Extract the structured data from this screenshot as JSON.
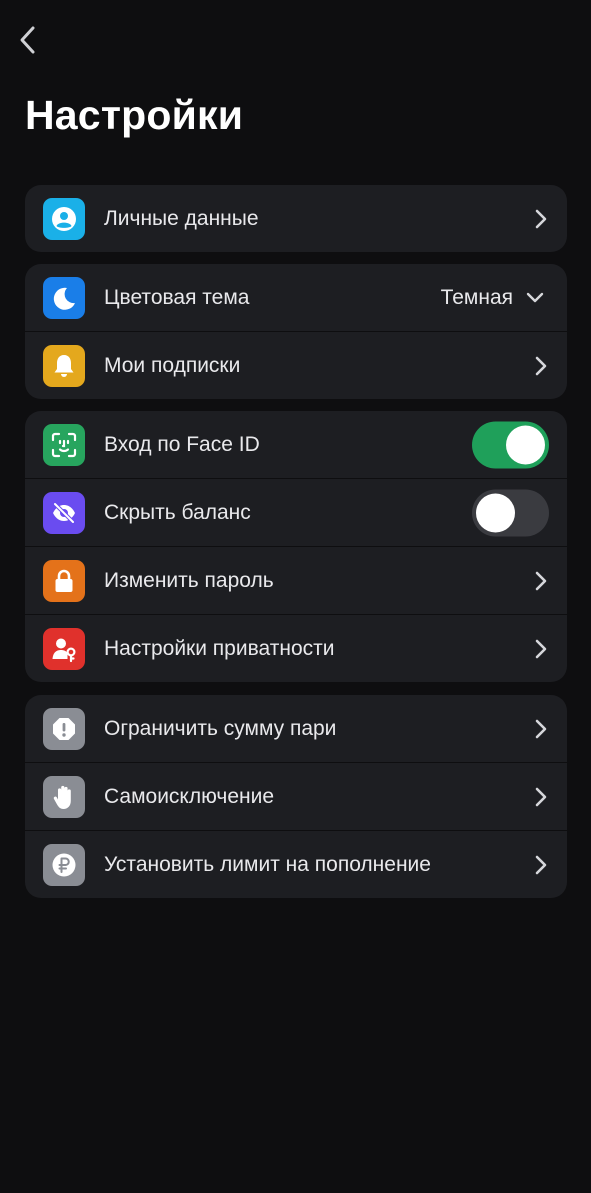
{
  "header": {
    "title": "Настройки",
    "back_icon": "chevron-left-icon"
  },
  "groups": [
    {
      "items": [
        {
          "label": "Личные данные",
          "icon": "user-icon",
          "icon_color": "#1ab0e8",
          "control": "chevron"
        }
      ]
    },
    {
      "items": [
        {
          "label": "Цветовая тема",
          "icon": "moon-icon",
          "icon_color": "#1a7ee8",
          "control": "dropdown",
          "value": "Темная"
        },
        {
          "label": "Мои подписки",
          "icon": "bell-icon",
          "icon_color": "#e4a81d",
          "control": "chevron"
        }
      ]
    },
    {
      "items": [
        {
          "label": "Вход по Face ID",
          "icon": "face-id-icon",
          "icon_color": "#27a55e",
          "control": "toggle",
          "on": true
        },
        {
          "label": "Скрыть баланс",
          "icon": "eye-off-icon",
          "icon_color": "#6a4cf0",
          "control": "toggle",
          "on": false
        },
        {
          "label": "Изменить пароль",
          "icon": "lock-icon",
          "icon_color": "#e4721a",
          "control": "chevron"
        },
        {
          "label": "Настройки приватности",
          "icon": "user-key-icon",
          "icon_color": "#e0312c",
          "control": "chevron"
        }
      ]
    },
    {
      "items": [
        {
          "label": "Ограничить сумму пари",
          "icon": "alert-octagon-icon",
          "icon_color": "#8a8d94",
          "control": "chevron"
        },
        {
          "label": "Самоисключение",
          "icon": "hand-icon",
          "icon_color": "#8a8d94",
          "control": "chevron"
        },
        {
          "label": "Установить лимит на пополнение",
          "icon": "ruble-icon",
          "icon_color": "#8a8d94",
          "control": "chevron"
        }
      ]
    }
  ],
  "colors": {
    "background": "#0e0e10",
    "card": "#1d1e22",
    "toggle_on": "#1fa05a",
    "toggle_off": "#3a3b40"
  }
}
